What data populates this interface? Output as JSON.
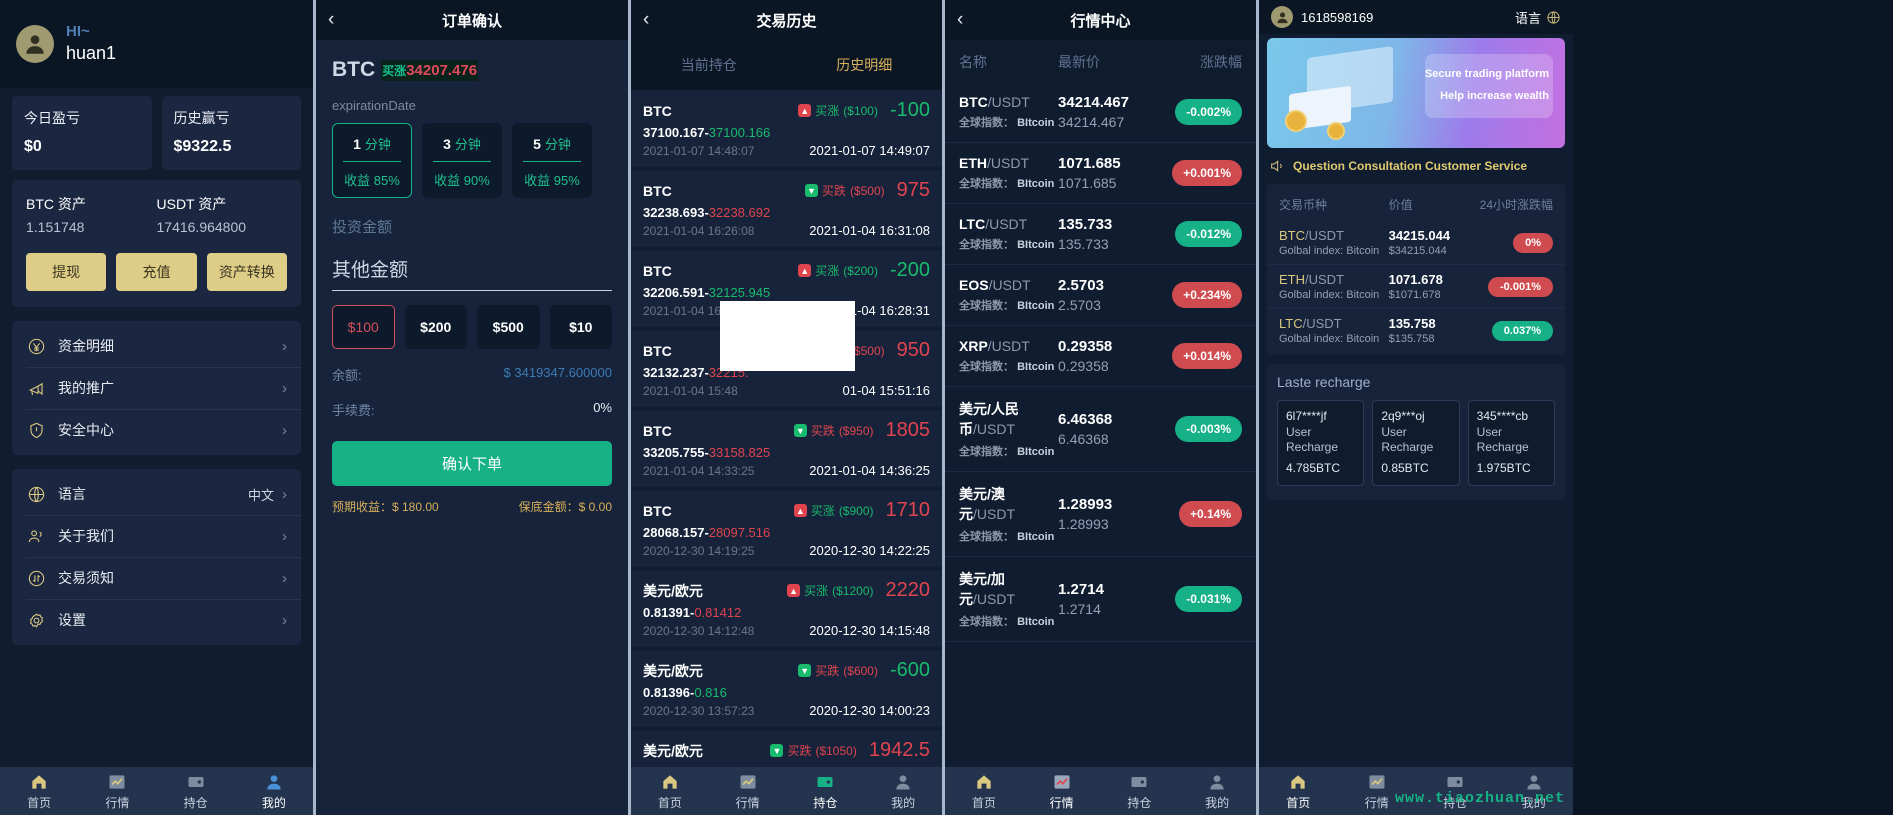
{
  "panel1": {
    "greeting": "HI~",
    "username": "huan1",
    "stats": [
      {
        "title": "今日盈亏",
        "value": "$0"
      },
      {
        "title": "历史赢亏",
        "value": "$9322.5"
      }
    ],
    "assets": [
      {
        "label": "BTC 资产",
        "value": "1.151748"
      },
      {
        "label": "USDT 资产",
        "value": "17416.964800"
      }
    ],
    "buttons": [
      "提现",
      "充值",
      "资产转换"
    ],
    "menu_group_1": [
      {
        "icon": "yen-circle-icon",
        "label": "资金明细"
      },
      {
        "icon": "megaphone-icon",
        "label": "我的推广"
      },
      {
        "icon": "shield-icon",
        "label": "安全中心"
      }
    ],
    "menu_group_2": [
      {
        "icon": "globe-icon",
        "label": "语言",
        "value": "中文"
      },
      {
        "icon": "users-icon",
        "label": "关于我们",
        "value": ""
      },
      {
        "icon": "exchange-icon",
        "label": "交易须知",
        "value": ""
      },
      {
        "icon": "gear-icon",
        "label": "设置",
        "value": ""
      }
    ],
    "tabs": [
      {
        "label": "首页",
        "icon": "home-icon",
        "active": false
      },
      {
        "label": "行情",
        "icon": "chart-icon",
        "active": false
      },
      {
        "label": "持仓",
        "icon": "wallet-icon",
        "active": false
      },
      {
        "label": "我的",
        "icon": "user-icon",
        "active": true
      }
    ]
  },
  "panel2": {
    "title": "订单确认",
    "back": "‹",
    "symbol": "BTC",
    "direction": "买涨",
    "price": "34207.476",
    "expiration_label": "expirationDate",
    "expirations": [
      {
        "num": "1",
        "unit": "分钟",
        "rate": "收益 85%",
        "selected": true
      },
      {
        "num": "3",
        "unit": "分钟",
        "rate": "收益 90%",
        "selected": false
      },
      {
        "num": "5",
        "unit": "分钟",
        "rate": "收益 95%",
        "selected": false
      }
    ],
    "invest_label": "投资金额",
    "other_amount": "其他金额",
    "amounts": [
      {
        "label": "$100",
        "selected": true
      },
      {
        "label": "$200",
        "selected": false
      },
      {
        "label": "$500",
        "selected": false
      },
      {
        "label": "$10",
        "selected": false
      }
    ],
    "balance_label": "余额:",
    "balance_value": "$ 3419347.600000",
    "fee_label": "手续费:",
    "fee_value": "0%",
    "confirm_label": "确认下单",
    "expected_profit": "预期收益：$ 180.00",
    "margin": "保底金额：$ 0.00"
  },
  "panel3": {
    "title": "交易历史",
    "back": "‹",
    "tabs": [
      {
        "label": "当前持仓",
        "active": false
      },
      {
        "label": "历史明细",
        "active": true
      }
    ],
    "rows": [
      {
        "sym": "BTC",
        "dir": "买涨",
        "dirtype": "up",
        "amt": "($100)",
        "open": "37100.167",
        "close": "37100.166",
        "closetype": "g",
        "date": "2021-01-07 14:48:07",
        "pl": "-100",
        "pltype": "neg",
        "rdate": "2021-01-07 14:49:07"
      },
      {
        "sym": "BTC",
        "dir": "买跌",
        "dirtype": "down",
        "amt": "($500)",
        "open": "32238.693",
        "close": "32238.692",
        "closetype": "r",
        "date": "2021-01-04 16:26:08",
        "pl": "975",
        "pltype": "pos",
        "rdate": "2021-01-04 16:31:08"
      },
      {
        "sym": "BTC",
        "dir": "买涨",
        "dirtype": "up",
        "amt": "($200)",
        "open": "32206.591",
        "close": "32125.945",
        "closetype": "g",
        "date": "2021-01-04 16:25:31",
        "pl": "-200",
        "pltype": "neg",
        "rdate": "2021-01-04 16:28:31"
      },
      {
        "sym": "BTC",
        "dir": "买跌",
        "dirtype": "down",
        "amt": "($500)",
        "open": "32132.237",
        "close": "32215.",
        "closetype": "r",
        "date": "2021-01-04 15:48",
        "pl": "950",
        "pltype": "pos",
        "rdate": "01-04 15:51:16"
      },
      {
        "sym": "BTC",
        "dir": "买跌",
        "dirtype": "down",
        "amt": "($950)",
        "open": "33205.755",
        "close": "33158.825",
        "closetype": "r",
        "date": "2021-01-04 14:33:25",
        "pl": "1805",
        "pltype": "pos",
        "rdate": "2021-01-04 14:36:25"
      },
      {
        "sym": "BTC",
        "dir": "买涨",
        "dirtype": "up",
        "amt": "($900)",
        "open": "28068.157",
        "close": "28097.516",
        "closetype": "r",
        "date": "2020-12-30 14:19:25",
        "pl": "1710",
        "pltype": "pos",
        "rdate": "2020-12-30 14:22:25"
      },
      {
        "sym": "美元/欧元",
        "dir": "买涨",
        "dirtype": "up",
        "amt": "($1200)",
        "open": "0.81391",
        "close": "0.81412",
        "closetype": "r",
        "date": "2020-12-30 14:12:48",
        "pl": "2220",
        "pltype": "pos",
        "rdate": "2020-12-30 14:15:48"
      },
      {
        "sym": "美元/欧元",
        "dir": "买跌",
        "dirtype": "down",
        "amt": "($600)",
        "open": "0.81396",
        "close": "0.816",
        "closetype": "g",
        "date": "2020-12-30 13:57:23",
        "pl": "-600",
        "pltype": "neg",
        "rdate": "2020-12-30 14:00:23"
      },
      {
        "sym": "美元/欧元",
        "dir": "买跌",
        "dirtype": "down",
        "amt": "($1050)",
        "open": "",
        "close": "",
        "closetype": "g",
        "date": "",
        "pl": "1942.5",
        "pltype": "pos",
        "rdate": ""
      }
    ],
    "tabbar": [
      {
        "label": "首页",
        "icon": "home-icon",
        "active": false
      },
      {
        "label": "行情",
        "icon": "chart-icon",
        "active": false
      },
      {
        "label": "持仓",
        "icon": "wallet-icon",
        "active": true
      },
      {
        "label": "我的",
        "icon": "user-icon",
        "active": false
      }
    ]
  },
  "panel4": {
    "title": "行情中心",
    "back": "‹",
    "headers": [
      "名称",
      "最新价",
      "涨跌幅"
    ],
    "index_label": "全球指数：",
    "index_name": "BItcoin",
    "rows": [
      {
        "base": "BTC",
        "quote": "/USDT",
        "p1": "34214.467",
        "p2": "34214.467",
        "chg": "-0.002%",
        "chgtype": "green"
      },
      {
        "base": "ETH",
        "quote": "/USDT",
        "p1": "1071.685",
        "p2": "1071.685",
        "chg": "+0.001%",
        "chgtype": "red"
      },
      {
        "base": "LTC",
        "quote": "/USDT",
        "p1": "135.733",
        "p2": "135.733",
        "chg": "-0.012%",
        "chgtype": "green"
      },
      {
        "base": "EOS",
        "quote": "/USDT",
        "p1": "2.5703",
        "p2": "2.5703",
        "chg": "+0.234%",
        "chgtype": "red"
      },
      {
        "base": "XRP",
        "quote": "/USDT",
        "p1": "0.29358",
        "p2": "0.29358",
        "chg": "+0.014%",
        "chgtype": "red"
      },
      {
        "base": "美元/人民币",
        "quote": "/USDT",
        "p1": "6.46368",
        "p2": "6.46368",
        "chg": "-0.003%",
        "chgtype": "green"
      },
      {
        "base": "美元/澳元",
        "quote": "/USDT",
        "p1": "1.28993",
        "p2": "1.28993",
        "chg": "+0.14%",
        "chgtype": "red"
      },
      {
        "base": "美元/加元",
        "quote": "/USDT",
        "p1": "1.2714",
        "p2": "1.2714",
        "chg": "-0.031%",
        "chgtype": "green"
      }
    ],
    "tabbar": [
      {
        "label": "首页",
        "icon": "home-icon",
        "active": false
      },
      {
        "label": "行情",
        "icon": "chart-icon",
        "active": true
      },
      {
        "label": "持仓",
        "icon": "wallet-icon",
        "active": false
      },
      {
        "label": "我的",
        "icon": "user-icon",
        "active": false
      }
    ]
  },
  "panel5": {
    "user_id": "1618598169",
    "lang_label": "语言",
    "banner_line1": "Secure trading platform",
    "banner_line2": "Help increase wealth",
    "notice": "Question Consultation Customer Service",
    "table_headers": [
      "交易币种",
      "价值",
      "24小时涨跌幅"
    ],
    "table_index_label": "Golbal index: Bitcoin",
    "rows": [
      {
        "pair": "BTC",
        "quote": "/USDT",
        "idx": "Golbal index: Bitcoin",
        "p1": "34215.044",
        "p2": "$34215.044",
        "chg": "0%",
        "chgtype": "red"
      },
      {
        "pair": "ETH",
        "quote": "/USDT",
        "idx": "Golbal index: Bitcoin",
        "p1": "1071.678",
        "p2": "$1071.678",
        "chg": "-0.001%",
        "chgtype": "red"
      },
      {
        "pair": "LTC",
        "quote": "/USDT",
        "idx": "Golbal index: Bitcoin",
        "p1": "135.758",
        "p2": "$135.758",
        "chg": "0.037%",
        "chgtype": "green"
      }
    ],
    "recharge_title": "Laste recharge",
    "recharge": [
      {
        "user": "6l7****jf",
        "msg": "User Recharge",
        "amount": "4.785BTC"
      },
      {
        "user": "2q9***oj",
        "msg": "User Recharge",
        "amount": "0.85BTC"
      },
      {
        "user": "345****cb",
        "msg": "User Recharge",
        "amount": "1.975BTC"
      }
    ],
    "tabbar": [
      {
        "label": "首页",
        "icon": "home-icon",
        "active": true
      },
      {
        "label": "行情",
        "icon": "chart-icon",
        "active": false
      },
      {
        "label": "持仓",
        "icon": "wallet-icon",
        "active": false
      },
      {
        "label": "我的",
        "icon": "user-icon",
        "active": false
      }
    ],
    "watermark": "www.tiaozhuan.net"
  },
  "colors": {
    "green": "#17b187",
    "red": "#cf4b4f",
    "gold": "#d9c87f",
    "panel_bg": "#101d30"
  }
}
